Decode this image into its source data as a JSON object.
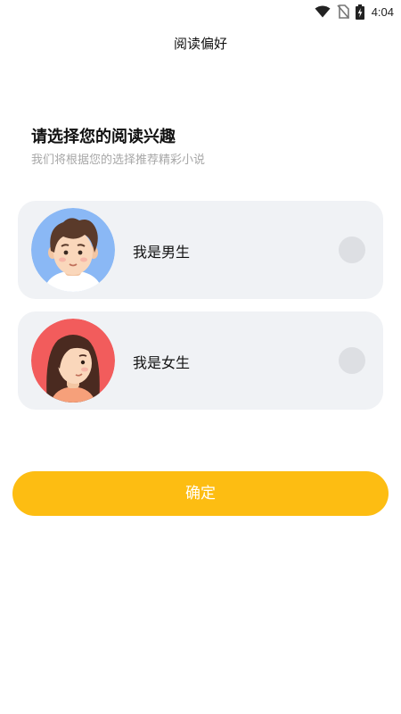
{
  "status_bar": {
    "time": "4:04",
    "icons": [
      "wifi-icon",
      "no-sim-icon",
      "battery-charging-icon"
    ]
  },
  "header": {
    "title": "阅读偏好"
  },
  "intro": {
    "heading": "请选择您的阅读兴趣",
    "subheading": "我们将根据您的选择推荐精彩小说"
  },
  "options": [
    {
      "label": "我是男生",
      "avatar": "male-avatar-icon",
      "avatar_bg": "#8ab8f5",
      "selected": false
    },
    {
      "label": "我是女生",
      "avatar": "female-avatar-icon",
      "avatar_bg": "#f25c5c",
      "selected": false
    }
  ],
  "confirm": {
    "label": "确定"
  },
  "colors": {
    "accent": "#fdbd12",
    "card_bg": "#f0f2f5",
    "radio_bg": "#dddfe3",
    "subtext": "#a7a7a7"
  }
}
